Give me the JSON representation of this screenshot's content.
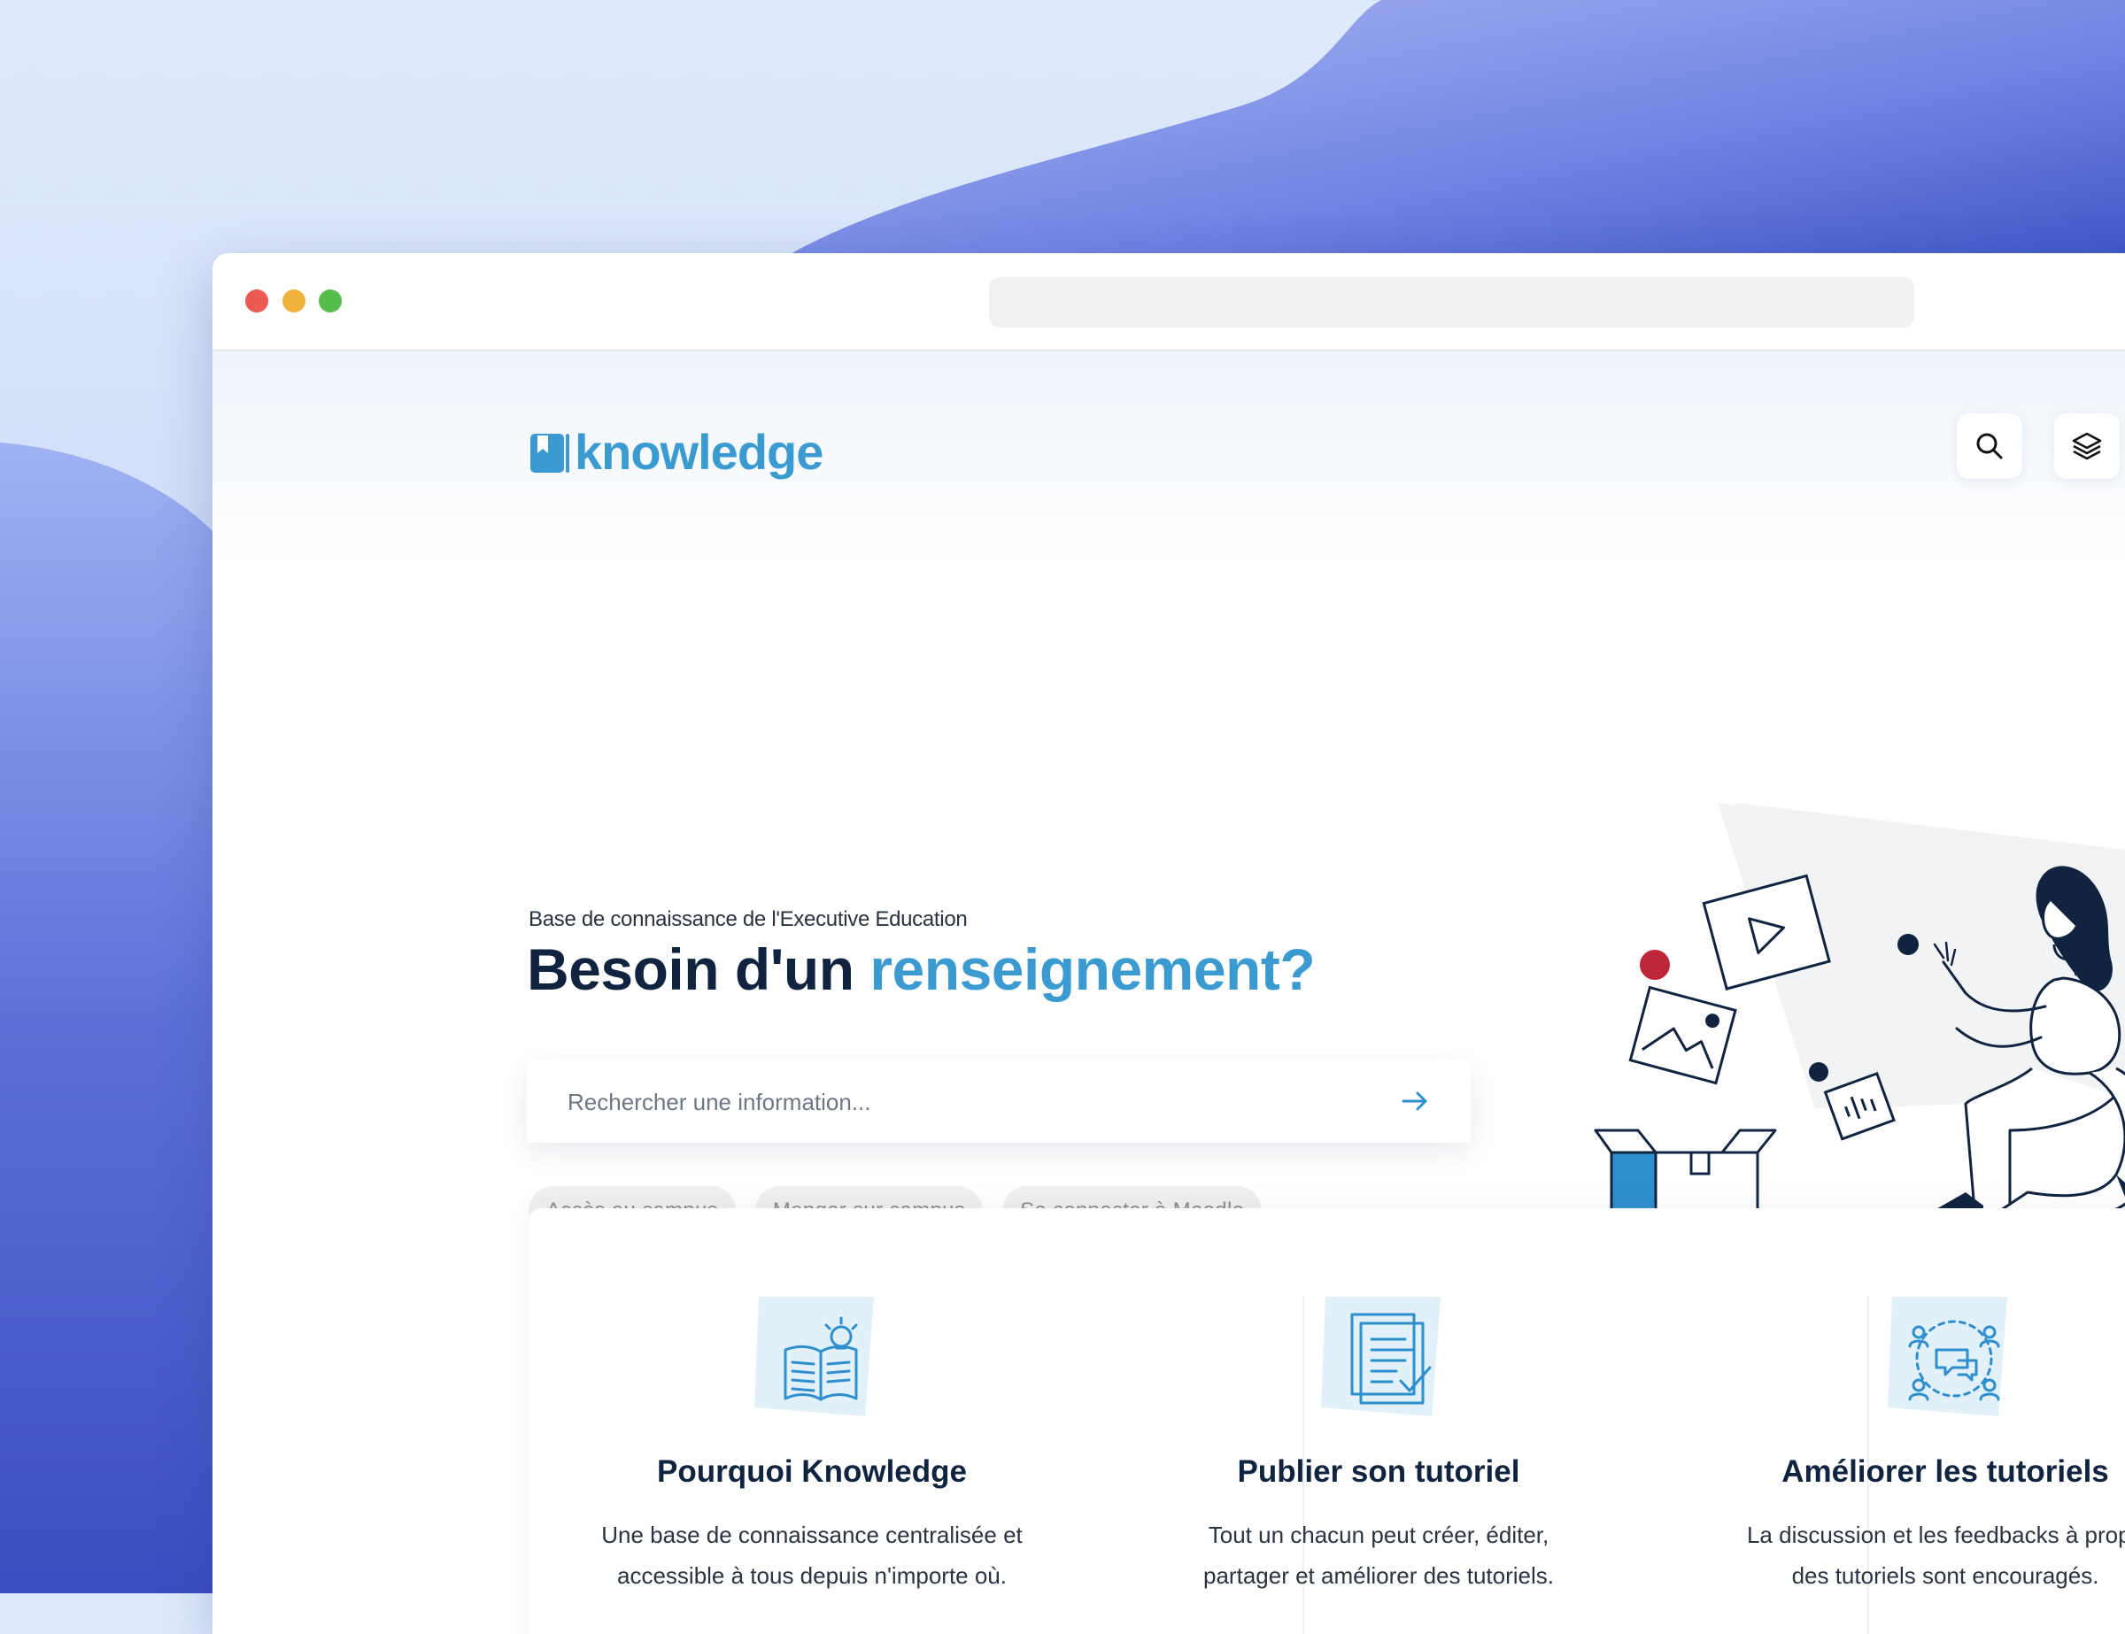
{
  "window": {
    "controls": [
      "close",
      "minimize",
      "maximize"
    ],
    "url": ""
  },
  "header": {
    "logo_text": "knowledge",
    "logo_icon": "book-icon",
    "actions": [
      {
        "name": "search",
        "icon": "search-icon"
      },
      {
        "name": "layers",
        "icon": "layers-icon"
      }
    ]
  },
  "hero": {
    "eyebrow": "Base de connaissance de l'Executive Education",
    "headline_part1": "Besoin d'un ",
    "headline_accent": "renseignement?",
    "search": {
      "placeholder": "Rechercher une information...",
      "submit_icon": "arrow-right-icon"
    },
    "chips": [
      "Accès au campus",
      "Manger sur campus",
      "Se connecter à Moodle"
    ]
  },
  "features": [
    {
      "icon": "book-lightbulb-icon",
      "title": "Pourquoi Knowledge",
      "desc_line1": "Une base de connaissance centralisée et",
      "desc_line2": "accessible à tous depuis n'importe où."
    },
    {
      "icon": "document-check-icon",
      "title": "Publier son tutoriel",
      "desc_line1": "Tout un chacun peut créer, éditer,",
      "desc_line2": "partager et améliorer des tutoriels."
    },
    {
      "icon": "discussion-people-icon",
      "title": "Améliorer les tutoriels",
      "desc_line1": "La discussion et les feedbacks à propo",
      "desc_line2": "des tutoriels sont encouragés."
    }
  ],
  "colors": {
    "brand": "#3b9bd1",
    "heading": "#102440",
    "accent_red": "#c0263a",
    "chip_bg": "#f0f0f0"
  }
}
